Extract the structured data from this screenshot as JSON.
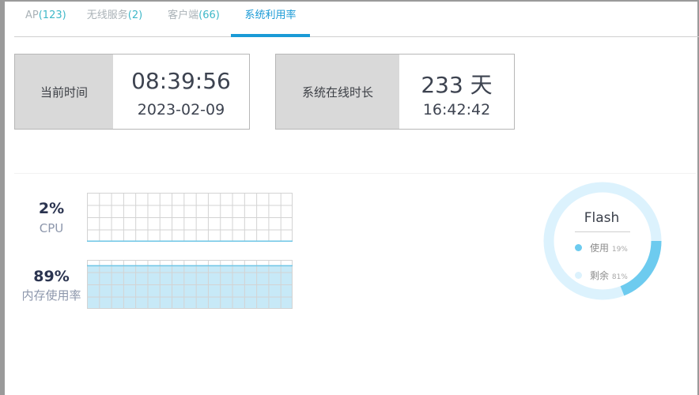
{
  "tabs": [
    {
      "name": "AP",
      "count": "(123)"
    },
    {
      "name": "无线服务",
      "count": "(2)"
    },
    {
      "name": "客户端",
      "count": "(66)"
    },
    {
      "name": "系统利用率",
      "count": ""
    }
  ],
  "cards": {
    "current_time": {
      "label": "当前时间",
      "time": "08:39:56",
      "date": "2023-02-09"
    },
    "uptime": {
      "label": "系统在线时长",
      "days": "233 天",
      "time": "16:42:42"
    }
  },
  "cpu": {
    "value": "2%",
    "label": "CPU",
    "percent": 2
  },
  "memory": {
    "value": "89%",
    "label": "内存使用率",
    "percent": 89
  },
  "flash": {
    "title": "Flash",
    "used_label": "使用",
    "used_pct": "19%",
    "used_value": 19,
    "free_label": "剩余",
    "free_pct": "81%",
    "free_value": 81,
    "colors": {
      "used": "#6dcbef",
      "free": "#dcf2fd"
    }
  }
}
